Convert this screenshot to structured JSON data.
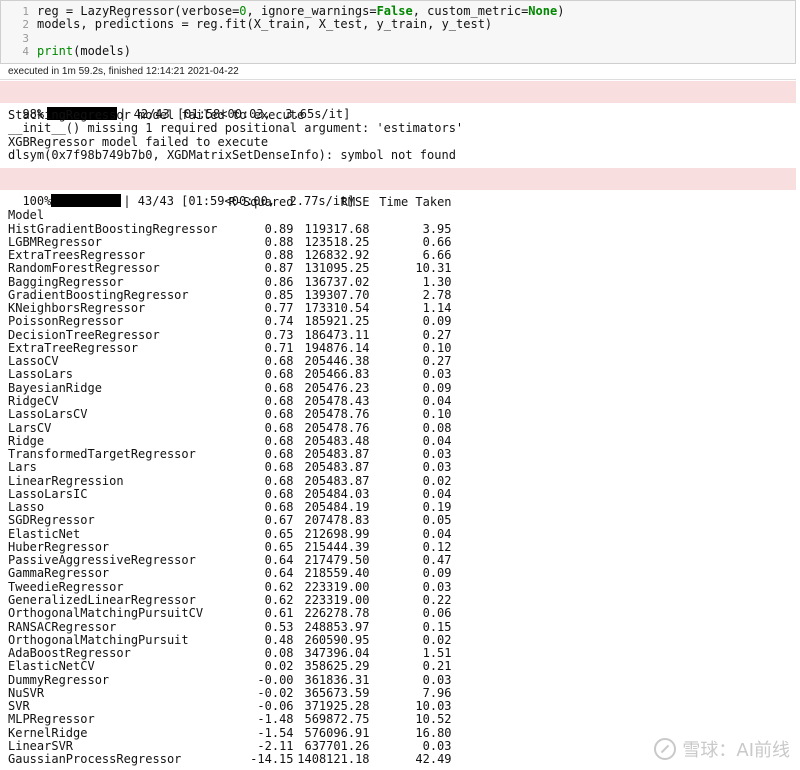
{
  "code_cell": {
    "line_numbers": [
      "1",
      "2",
      "3",
      "4"
    ],
    "line1_a": "reg = LazyRegressor(verbose=",
    "line1_zero": "0",
    "line1_b": ", ignore_warnings=",
    "line1_false": "False",
    "line1_c": ", custom_metric=",
    "line1_none": "None",
    "line1_d": ")",
    "line2": "models, predictions = reg.fit(X_train, X_test, y_train, y_test)",
    "line3": "",
    "line4_fn": "print",
    "line4_rest": "(models)"
  },
  "execution_info": "executed in 1m 59.2s, finished 12:14:21 2021-04-22",
  "progress1": {
    "pct": "98%",
    "text": "| 42/43 [01:58<00:03,  3.65s/it]",
    "fraction": 0.977
  },
  "stderr_lines": [
    "StackingRegressor model failed to execute",
    "__init__() missing 1 required positional argument: 'estimators'",
    "XGBRegressor model failed to execute",
    "dlsym(0x7f98b749b7b0, XGDMatrixSetDenseInfo): symbol not found"
  ],
  "progress2": {
    "pct": "100%",
    "text": "| 43/43 [01:59<00:00,  2.77s/it]",
    "fraction": 1.0
  },
  "table": {
    "columns": [
      "R-Squared",
      "RMSE",
      "Time Taken"
    ],
    "index_name": "Model",
    "rows": [
      [
        "HistGradientBoostingRegressor",
        "0.89",
        "119317.68",
        "3.95"
      ],
      [
        "LGBMRegressor",
        "0.88",
        "123518.25",
        "0.66"
      ],
      [
        "ExtraTreesRegressor",
        "0.88",
        "126832.92",
        "6.66"
      ],
      [
        "RandomForestRegressor",
        "0.87",
        "131095.25",
        "10.31"
      ],
      [
        "BaggingRegressor",
        "0.86",
        "136737.02",
        "1.30"
      ],
      [
        "GradientBoostingRegressor",
        "0.85",
        "139307.70",
        "2.78"
      ],
      [
        "KNeighborsRegressor",
        "0.77",
        "173310.54",
        "1.14"
      ],
      [
        "PoissonRegressor",
        "0.74",
        "185921.25",
        "0.09"
      ],
      [
        "DecisionTreeRegressor",
        "0.73",
        "186473.11",
        "0.27"
      ],
      [
        "ExtraTreeRegressor",
        "0.71",
        "194876.14",
        "0.10"
      ],
      [
        "LassoCV",
        "0.68",
        "205446.38",
        "0.27"
      ],
      [
        "LassoLars",
        "0.68",
        "205466.83",
        "0.03"
      ],
      [
        "BayesianRidge",
        "0.68",
        "205476.23",
        "0.09"
      ],
      [
        "RidgeCV",
        "0.68",
        "205478.43",
        "0.04"
      ],
      [
        "LassoLarsCV",
        "0.68",
        "205478.76",
        "0.10"
      ],
      [
        "LarsCV",
        "0.68",
        "205478.76",
        "0.08"
      ],
      [
        "Ridge",
        "0.68",
        "205483.48",
        "0.04"
      ],
      [
        "TransformedTargetRegressor",
        "0.68",
        "205483.87",
        "0.03"
      ],
      [
        "Lars",
        "0.68",
        "205483.87",
        "0.03"
      ],
      [
        "LinearRegression",
        "0.68",
        "205483.87",
        "0.02"
      ],
      [
        "LassoLarsIC",
        "0.68",
        "205484.03",
        "0.04"
      ],
      [
        "Lasso",
        "0.68",
        "205484.19",
        "0.19"
      ],
      [
        "SGDRegressor",
        "0.67",
        "207478.83",
        "0.05"
      ],
      [
        "ElasticNet",
        "0.65",
        "212698.99",
        "0.04"
      ],
      [
        "HuberRegressor",
        "0.65",
        "215444.39",
        "0.12"
      ],
      [
        "PassiveAggressiveRegressor",
        "0.64",
        "217479.50",
        "0.47"
      ],
      [
        "GammaRegressor",
        "0.64",
        "218559.40",
        "0.09"
      ],
      [
        "TweedieRegressor",
        "0.62",
        "223319.00",
        "0.03"
      ],
      [
        "GeneralizedLinearRegressor",
        "0.62",
        "223319.00",
        "0.22"
      ],
      [
        "OrthogonalMatchingPursuitCV",
        "0.61",
        "226278.78",
        "0.06"
      ],
      [
        "RANSACRegressor",
        "0.53",
        "248853.97",
        "0.15"
      ],
      [
        "OrthogonalMatchingPursuit",
        "0.48",
        "260590.95",
        "0.02"
      ],
      [
        "AdaBoostRegressor",
        "0.08",
        "347396.04",
        "1.51"
      ],
      [
        "ElasticNetCV",
        "0.02",
        "358625.29",
        "0.21"
      ],
      [
        "DummyRegressor",
        "-0.00",
        "361836.31",
        "0.03"
      ],
      [
        "NuSVR",
        "-0.02",
        "365673.59",
        "7.96"
      ],
      [
        "SVR",
        "-0.06",
        "371925.28",
        "10.03"
      ],
      [
        "MLPRegressor",
        "-1.48",
        "569872.75",
        "10.52"
      ],
      [
        "KernelRidge",
        "-1.54",
        "576096.91",
        "16.80"
      ],
      [
        "LinearSVR",
        "-2.11",
        "637701.26",
        "0.03"
      ],
      [
        "GaussianProcessRegressor",
        "-14.15",
        "1408121.18",
        "42.49"
      ]
    ]
  },
  "watermark": "雪球：AI前线",
  "watermark_icon": "snowball-logo-icon"
}
